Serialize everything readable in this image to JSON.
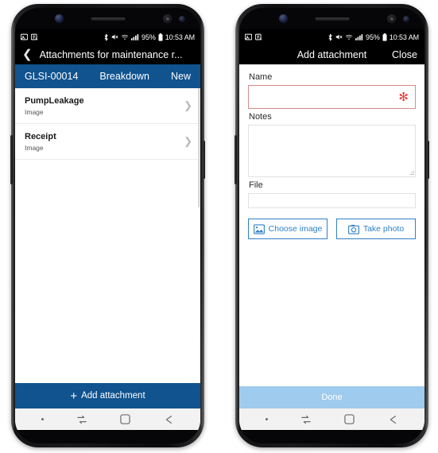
{
  "status_bar": {
    "icons_left": [
      "image-icon",
      "screenshot-icon"
    ],
    "icons_right": [
      "bluetooth-icon",
      "mute-icon",
      "wifi-icon",
      "signal-icon"
    ],
    "battery": "95%",
    "battery_icon": "battery-icon",
    "time": "10:53 AM"
  },
  "phone_left": {
    "title_bar": {
      "back_icon": "chevron-left-icon",
      "title": "Attachments for maintenance r..."
    },
    "context_bar": {
      "id": "GLSI-00014",
      "type": "Breakdown",
      "status": "New",
      "color": "#10538f"
    },
    "list": [
      {
        "title": "PumpLeakage",
        "subtitle": "Image",
        "chevron": "chevron-right-icon"
      },
      {
        "title": "Receipt",
        "subtitle": "Image",
        "chevron": "chevron-right-icon"
      }
    ],
    "action_bar": {
      "plus_icon": "plus-icon",
      "label": "Add attachment",
      "color": "#10538f"
    }
  },
  "phone_right": {
    "title_bar": {
      "title": "Add attachment",
      "close_label": "Close"
    },
    "fields": {
      "name_label": "Name",
      "name_value": "",
      "name_required_marker": "✻",
      "name_border_color": "#d98a8a",
      "notes_label": "Notes",
      "notes_value": "",
      "file_label": "File",
      "file_value": ""
    },
    "buttons": [
      {
        "label": "Choose image",
        "icon": "picture-icon",
        "color": "#2f80c8"
      },
      {
        "label": "Take photo",
        "icon": "camera-icon",
        "color": "#2f80c8"
      }
    ],
    "done_bar": {
      "label": "Done",
      "color": "#9fcbee"
    }
  },
  "nav_bar": {
    "items": [
      {
        "name": "nav-dot",
        "icon": "dot-icon"
      },
      {
        "name": "nav-recents",
        "icon": "recents-icon"
      },
      {
        "name": "nav-home",
        "icon": "home-square-icon"
      },
      {
        "name": "nav-back",
        "icon": "arrow-left-icon"
      }
    ]
  }
}
